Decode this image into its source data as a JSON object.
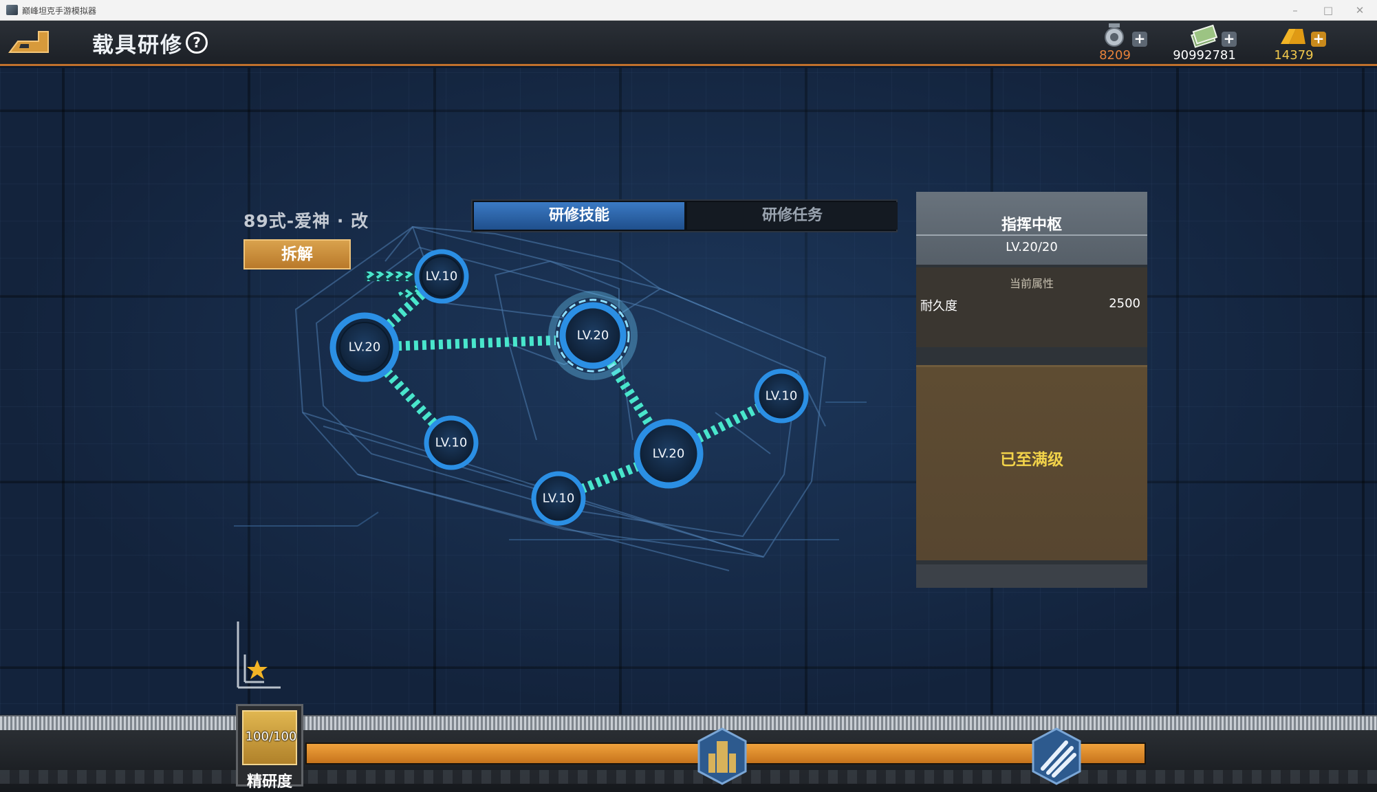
{
  "window": {
    "title": "巅峰坦克手游模拟器"
  },
  "header": {
    "title": "载具研修",
    "help_icon": "help-icon",
    "resources": [
      {
        "name": "medal",
        "icon": "medal-icon",
        "value": "8209",
        "color": "#e8823a"
      },
      {
        "name": "cash",
        "icon": "cash-icon",
        "value": "90992781",
        "color": "#ffffff"
      },
      {
        "name": "gold",
        "icon": "gold-icon",
        "value": "14379",
        "color": "#f2c94c"
      }
    ]
  },
  "vehicle": {
    "name": "89式-爱神 · 改",
    "dismantle_label": "拆解"
  },
  "tabs": {
    "active": "研修技能",
    "inactive": "研修任务"
  },
  "skill_nodes": [
    {
      "id": "n1",
      "label": "LV.10"
    },
    {
      "id": "n2",
      "label": "LV.20"
    },
    {
      "id": "n3",
      "label": "LV.20"
    },
    {
      "id": "n4",
      "label": "LV.10"
    },
    {
      "id": "n5",
      "label": "LV.10"
    },
    {
      "id": "n6",
      "label": "LV.20"
    },
    {
      "id": "n7",
      "label": "LV.10"
    }
  ],
  "panel": {
    "title": "指挥中枢",
    "level": "LV.20/20",
    "attr_header": "当前属性",
    "attr_name": "耐久度",
    "attr_value": "2500",
    "status": "已至满级"
  },
  "progress": {
    "label": "精研度",
    "value_text": "100/100",
    "fraction": 1.0,
    "milestones": [
      "tower-icon",
      "claw-icon"
    ]
  },
  "colors": {
    "accent_orange": "#c0702c",
    "node_ring": "#2e8fe0",
    "chain": "#3fe0c8",
    "max_text": "#f2d34a"
  }
}
